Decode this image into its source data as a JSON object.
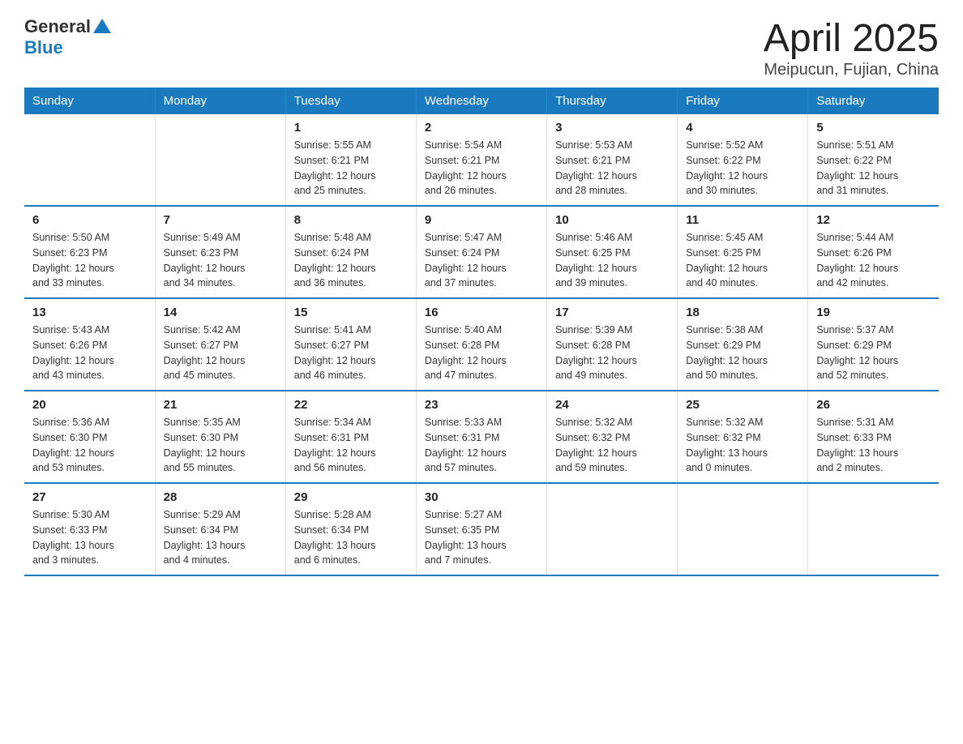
{
  "header": {
    "logo_text": "General",
    "logo_blue": "Blue",
    "title": "April 2025",
    "subtitle": "Meipucun, Fujian, China"
  },
  "days_of_week": [
    "Sunday",
    "Monday",
    "Tuesday",
    "Wednesday",
    "Thursday",
    "Friday",
    "Saturday"
  ],
  "weeks": [
    [
      {
        "day": "",
        "info": ""
      },
      {
        "day": "",
        "info": ""
      },
      {
        "day": "1",
        "info": "Sunrise: 5:55 AM\nSunset: 6:21 PM\nDaylight: 12 hours\nand 25 minutes."
      },
      {
        "day": "2",
        "info": "Sunrise: 5:54 AM\nSunset: 6:21 PM\nDaylight: 12 hours\nand 26 minutes."
      },
      {
        "day": "3",
        "info": "Sunrise: 5:53 AM\nSunset: 6:21 PM\nDaylight: 12 hours\nand 28 minutes."
      },
      {
        "day": "4",
        "info": "Sunrise: 5:52 AM\nSunset: 6:22 PM\nDaylight: 12 hours\nand 30 minutes."
      },
      {
        "day": "5",
        "info": "Sunrise: 5:51 AM\nSunset: 6:22 PM\nDaylight: 12 hours\nand 31 minutes."
      }
    ],
    [
      {
        "day": "6",
        "info": "Sunrise: 5:50 AM\nSunset: 6:23 PM\nDaylight: 12 hours\nand 33 minutes."
      },
      {
        "day": "7",
        "info": "Sunrise: 5:49 AM\nSunset: 6:23 PM\nDaylight: 12 hours\nand 34 minutes."
      },
      {
        "day": "8",
        "info": "Sunrise: 5:48 AM\nSunset: 6:24 PM\nDaylight: 12 hours\nand 36 minutes."
      },
      {
        "day": "9",
        "info": "Sunrise: 5:47 AM\nSunset: 6:24 PM\nDaylight: 12 hours\nand 37 minutes."
      },
      {
        "day": "10",
        "info": "Sunrise: 5:46 AM\nSunset: 6:25 PM\nDaylight: 12 hours\nand 39 minutes."
      },
      {
        "day": "11",
        "info": "Sunrise: 5:45 AM\nSunset: 6:25 PM\nDaylight: 12 hours\nand 40 minutes."
      },
      {
        "day": "12",
        "info": "Sunrise: 5:44 AM\nSunset: 6:26 PM\nDaylight: 12 hours\nand 42 minutes."
      }
    ],
    [
      {
        "day": "13",
        "info": "Sunrise: 5:43 AM\nSunset: 6:26 PM\nDaylight: 12 hours\nand 43 minutes."
      },
      {
        "day": "14",
        "info": "Sunrise: 5:42 AM\nSunset: 6:27 PM\nDaylight: 12 hours\nand 45 minutes."
      },
      {
        "day": "15",
        "info": "Sunrise: 5:41 AM\nSunset: 6:27 PM\nDaylight: 12 hours\nand 46 minutes."
      },
      {
        "day": "16",
        "info": "Sunrise: 5:40 AM\nSunset: 6:28 PM\nDaylight: 12 hours\nand 47 minutes."
      },
      {
        "day": "17",
        "info": "Sunrise: 5:39 AM\nSunset: 6:28 PM\nDaylight: 12 hours\nand 49 minutes."
      },
      {
        "day": "18",
        "info": "Sunrise: 5:38 AM\nSunset: 6:29 PM\nDaylight: 12 hours\nand 50 minutes."
      },
      {
        "day": "19",
        "info": "Sunrise: 5:37 AM\nSunset: 6:29 PM\nDaylight: 12 hours\nand 52 minutes."
      }
    ],
    [
      {
        "day": "20",
        "info": "Sunrise: 5:36 AM\nSunset: 6:30 PM\nDaylight: 12 hours\nand 53 minutes."
      },
      {
        "day": "21",
        "info": "Sunrise: 5:35 AM\nSunset: 6:30 PM\nDaylight: 12 hours\nand 55 minutes."
      },
      {
        "day": "22",
        "info": "Sunrise: 5:34 AM\nSunset: 6:31 PM\nDaylight: 12 hours\nand 56 minutes."
      },
      {
        "day": "23",
        "info": "Sunrise: 5:33 AM\nSunset: 6:31 PM\nDaylight: 12 hours\nand 57 minutes."
      },
      {
        "day": "24",
        "info": "Sunrise: 5:32 AM\nSunset: 6:32 PM\nDaylight: 12 hours\nand 59 minutes."
      },
      {
        "day": "25",
        "info": "Sunrise: 5:32 AM\nSunset: 6:32 PM\nDaylight: 13 hours\nand 0 minutes."
      },
      {
        "day": "26",
        "info": "Sunrise: 5:31 AM\nSunset: 6:33 PM\nDaylight: 13 hours\nand 2 minutes."
      }
    ],
    [
      {
        "day": "27",
        "info": "Sunrise: 5:30 AM\nSunset: 6:33 PM\nDaylight: 13 hours\nand 3 minutes."
      },
      {
        "day": "28",
        "info": "Sunrise: 5:29 AM\nSunset: 6:34 PM\nDaylight: 13 hours\nand 4 minutes."
      },
      {
        "day": "29",
        "info": "Sunrise: 5:28 AM\nSunset: 6:34 PM\nDaylight: 13 hours\nand 6 minutes."
      },
      {
        "day": "30",
        "info": "Sunrise: 5:27 AM\nSunset: 6:35 PM\nDaylight: 13 hours\nand 7 minutes."
      },
      {
        "day": "",
        "info": ""
      },
      {
        "day": "",
        "info": ""
      },
      {
        "day": "",
        "info": ""
      }
    ]
  ]
}
